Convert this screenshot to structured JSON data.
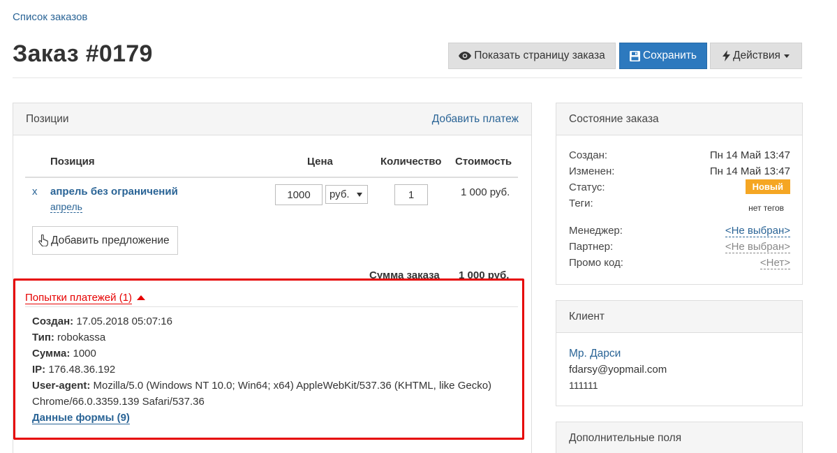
{
  "breadcrumb": "Список заказов",
  "page_title": "Заказ #0179",
  "toolbar": {
    "view_page": "Показать страницу заказа",
    "save": "Сохранить",
    "actions": "Действия"
  },
  "positions": {
    "title": "Позиции",
    "add_payment": "Добавить платеж",
    "headers": {
      "position": "Позиция",
      "price": "Цена",
      "quantity": "Количество",
      "cost": "Стоимость"
    },
    "item": {
      "remove": "x",
      "name": "апрель без ограничений",
      "sub": "апрель",
      "price": "1000",
      "currency": "руб.",
      "quantity": "1",
      "cost": "1 000 руб."
    },
    "add_offer": "Добавить предложение",
    "total_label": "Сумма заказа",
    "total_value": "1 000 руб."
  },
  "payment_attempts": {
    "link": "Попытки платежей (1)",
    "created_label": "Создан:",
    "created_value": "17.05.2018 05:07:16",
    "type_label": "Тип:",
    "type_value": "robokassa",
    "sum_label": "Сумма:",
    "sum_value": "1000",
    "ip_label": "IP:",
    "ip_value": "176.48.36.192",
    "ua_label": "User-agent:",
    "ua_value_line1": "Mozilla/5.0 (Windows NT 10.0; Win64; x64) AppleWebKit/537.36 (KHTML, like Gecko)",
    "ua_value_line2": "Chrome/66.0.3359.139 Safari/537.36",
    "form_data": "Данные формы (9)"
  },
  "order_state": {
    "title": "Состояние заказа",
    "created_label": "Создан:",
    "created_value": "Пн 14 Май 13:47",
    "changed_label": "Изменен:",
    "changed_value": "Пн 14 Май 13:47",
    "status_label": "Статус:",
    "status_value": "Новый",
    "tags_label": "Теги:",
    "tags_value": "нет тегов",
    "manager_label": "Менеджер:",
    "manager_value": "<Не выбран>",
    "partner_label": "Партнер:",
    "partner_value": "<Не выбран>",
    "promo_label": "Промо код:",
    "promo_value": "<Нет>"
  },
  "client": {
    "title": "Клиент",
    "name": "Мр. Дарси",
    "email": "fdarsy@yopmail.com",
    "phone": "111111"
  },
  "extra_fields": {
    "title": "Дополнительные поля"
  },
  "colors": {
    "link": "#2a6496",
    "primary": "#2d79be",
    "badge": "#f5a623",
    "highlight": "#e60000"
  }
}
